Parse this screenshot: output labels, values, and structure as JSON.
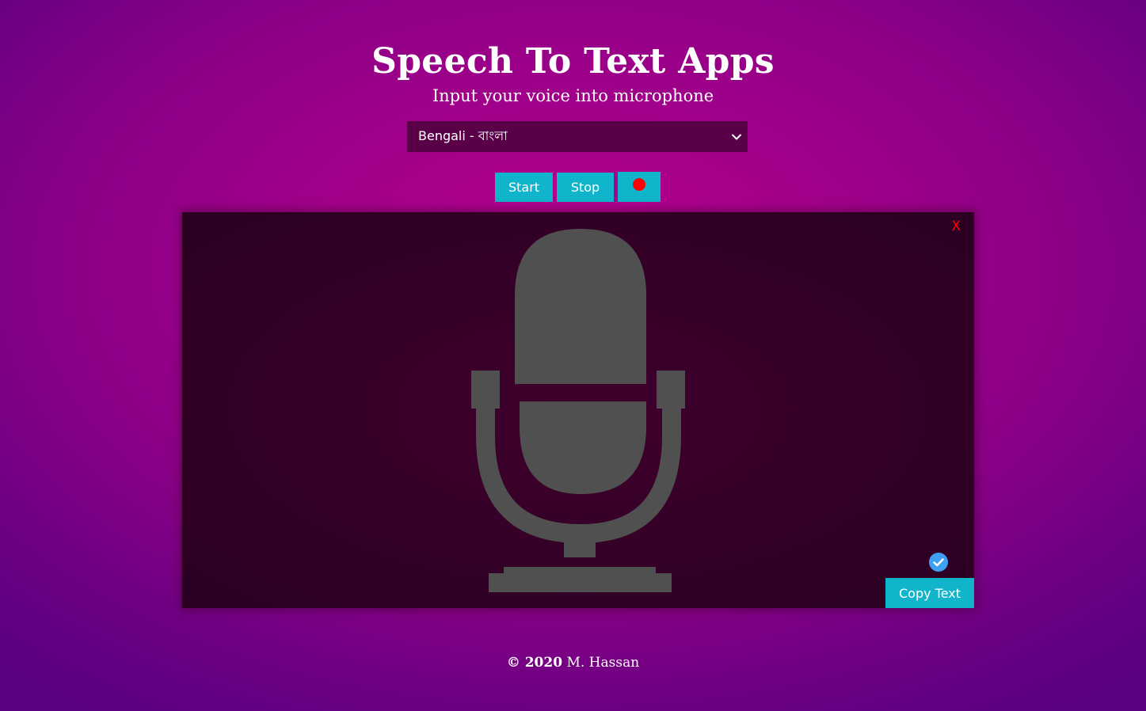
{
  "header": {
    "title": "Speech To Text Apps",
    "subtitle": "Input your voice into microphone"
  },
  "language_select": {
    "selected": "Bengali - বাংলা",
    "icon": "chevron-down-icon"
  },
  "controls": {
    "start_label": "Start",
    "stop_label": "Stop",
    "record_icon": "record-dot-icon",
    "button_color": "#10b4cb",
    "record_color": "#ff0000"
  },
  "panel": {
    "close_label": "X",
    "placeholder_icon": "microphone-icon",
    "check_icon": "check-circle-icon",
    "copy_label": "Copy Text"
  },
  "footer": {
    "copyright": "© 2020",
    "author": "M. Hassan"
  }
}
